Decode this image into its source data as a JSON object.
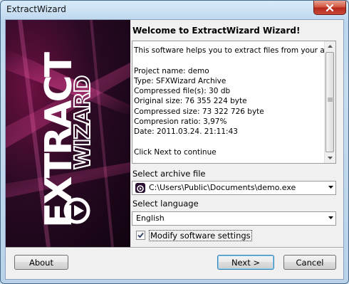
{
  "window": {
    "title": "ExtractWizard"
  },
  "banner": {
    "logo_text": "EXTRACT WIZARD"
  },
  "panel": {
    "welcome": "Welcome to ExtractWizard Wizard!",
    "info_lines": [
      "This software helps you to extract files from your archive",
      "",
      "Project name: demo",
      "Type: SFXWizard Archive",
      "Compressed file(s): 30 db",
      "Original size: 76 355 224 byte",
      "Compressed size: 73 322 726 byte",
      "Compresion ratio: 3,97%",
      "Date: 2011.03.24. 21:11:43",
      "",
      "Click Next to continue"
    ],
    "archive_label": "Select archive file",
    "archive_value": "C:\\Users\\Public\\Documents\\demo.exe",
    "language_label": "Select language",
    "language_value": "English",
    "modify_label": "Modify software settings",
    "modify_checked": true
  },
  "buttons": {
    "about": "About",
    "next": "Next >",
    "cancel": "Cancel"
  }
}
